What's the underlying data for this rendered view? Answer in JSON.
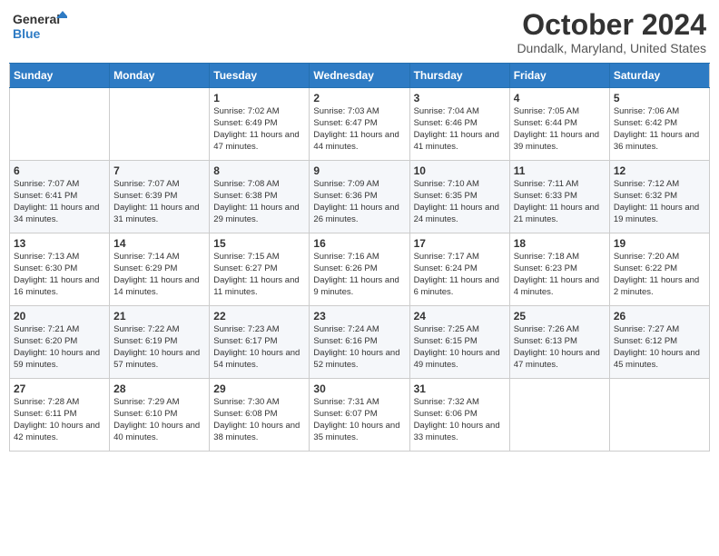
{
  "header": {
    "logo_general": "General",
    "logo_blue": "Blue",
    "month_title": "October 2024",
    "location": "Dundalk, Maryland, United States"
  },
  "days_of_week": [
    "Sunday",
    "Monday",
    "Tuesday",
    "Wednesday",
    "Thursday",
    "Friday",
    "Saturday"
  ],
  "weeks": [
    [
      {
        "day": "",
        "content": ""
      },
      {
        "day": "",
        "content": ""
      },
      {
        "day": "1",
        "content": "Sunrise: 7:02 AM\nSunset: 6:49 PM\nDaylight: 11 hours and 47 minutes."
      },
      {
        "day": "2",
        "content": "Sunrise: 7:03 AM\nSunset: 6:47 PM\nDaylight: 11 hours and 44 minutes."
      },
      {
        "day": "3",
        "content": "Sunrise: 7:04 AM\nSunset: 6:46 PM\nDaylight: 11 hours and 41 minutes."
      },
      {
        "day": "4",
        "content": "Sunrise: 7:05 AM\nSunset: 6:44 PM\nDaylight: 11 hours and 39 minutes."
      },
      {
        "day": "5",
        "content": "Sunrise: 7:06 AM\nSunset: 6:42 PM\nDaylight: 11 hours and 36 minutes."
      }
    ],
    [
      {
        "day": "6",
        "content": "Sunrise: 7:07 AM\nSunset: 6:41 PM\nDaylight: 11 hours and 34 minutes."
      },
      {
        "day": "7",
        "content": "Sunrise: 7:07 AM\nSunset: 6:39 PM\nDaylight: 11 hours and 31 minutes."
      },
      {
        "day": "8",
        "content": "Sunrise: 7:08 AM\nSunset: 6:38 PM\nDaylight: 11 hours and 29 minutes."
      },
      {
        "day": "9",
        "content": "Sunrise: 7:09 AM\nSunset: 6:36 PM\nDaylight: 11 hours and 26 minutes."
      },
      {
        "day": "10",
        "content": "Sunrise: 7:10 AM\nSunset: 6:35 PM\nDaylight: 11 hours and 24 minutes."
      },
      {
        "day": "11",
        "content": "Sunrise: 7:11 AM\nSunset: 6:33 PM\nDaylight: 11 hours and 21 minutes."
      },
      {
        "day": "12",
        "content": "Sunrise: 7:12 AM\nSunset: 6:32 PM\nDaylight: 11 hours and 19 minutes."
      }
    ],
    [
      {
        "day": "13",
        "content": "Sunrise: 7:13 AM\nSunset: 6:30 PM\nDaylight: 11 hours and 16 minutes."
      },
      {
        "day": "14",
        "content": "Sunrise: 7:14 AM\nSunset: 6:29 PM\nDaylight: 11 hours and 14 minutes."
      },
      {
        "day": "15",
        "content": "Sunrise: 7:15 AM\nSunset: 6:27 PM\nDaylight: 11 hours and 11 minutes."
      },
      {
        "day": "16",
        "content": "Sunrise: 7:16 AM\nSunset: 6:26 PM\nDaylight: 11 hours and 9 minutes."
      },
      {
        "day": "17",
        "content": "Sunrise: 7:17 AM\nSunset: 6:24 PM\nDaylight: 11 hours and 6 minutes."
      },
      {
        "day": "18",
        "content": "Sunrise: 7:18 AM\nSunset: 6:23 PM\nDaylight: 11 hours and 4 minutes."
      },
      {
        "day": "19",
        "content": "Sunrise: 7:20 AM\nSunset: 6:22 PM\nDaylight: 11 hours and 2 minutes."
      }
    ],
    [
      {
        "day": "20",
        "content": "Sunrise: 7:21 AM\nSunset: 6:20 PM\nDaylight: 10 hours and 59 minutes."
      },
      {
        "day": "21",
        "content": "Sunrise: 7:22 AM\nSunset: 6:19 PM\nDaylight: 10 hours and 57 minutes."
      },
      {
        "day": "22",
        "content": "Sunrise: 7:23 AM\nSunset: 6:17 PM\nDaylight: 10 hours and 54 minutes."
      },
      {
        "day": "23",
        "content": "Sunrise: 7:24 AM\nSunset: 6:16 PM\nDaylight: 10 hours and 52 minutes."
      },
      {
        "day": "24",
        "content": "Sunrise: 7:25 AM\nSunset: 6:15 PM\nDaylight: 10 hours and 49 minutes."
      },
      {
        "day": "25",
        "content": "Sunrise: 7:26 AM\nSunset: 6:13 PM\nDaylight: 10 hours and 47 minutes."
      },
      {
        "day": "26",
        "content": "Sunrise: 7:27 AM\nSunset: 6:12 PM\nDaylight: 10 hours and 45 minutes."
      }
    ],
    [
      {
        "day": "27",
        "content": "Sunrise: 7:28 AM\nSunset: 6:11 PM\nDaylight: 10 hours and 42 minutes."
      },
      {
        "day": "28",
        "content": "Sunrise: 7:29 AM\nSunset: 6:10 PM\nDaylight: 10 hours and 40 minutes."
      },
      {
        "day": "29",
        "content": "Sunrise: 7:30 AM\nSunset: 6:08 PM\nDaylight: 10 hours and 38 minutes."
      },
      {
        "day": "30",
        "content": "Sunrise: 7:31 AM\nSunset: 6:07 PM\nDaylight: 10 hours and 35 minutes."
      },
      {
        "day": "31",
        "content": "Sunrise: 7:32 AM\nSunset: 6:06 PM\nDaylight: 10 hours and 33 minutes."
      },
      {
        "day": "",
        "content": ""
      },
      {
        "day": "",
        "content": ""
      }
    ]
  ]
}
